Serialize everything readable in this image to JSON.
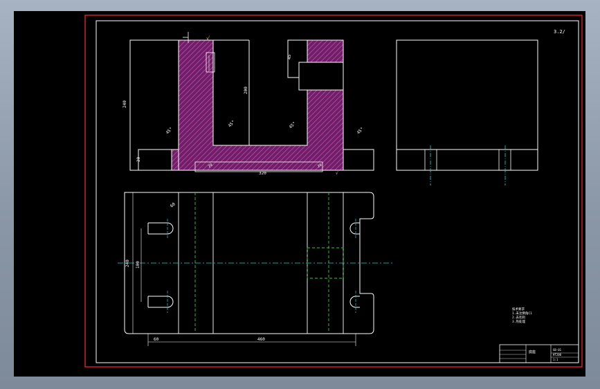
{
  "drawing": {
    "corner_mark": "3.2/",
    "roughness_note": "√",
    "top_view_dims": {
      "height_left": "240",
      "height_inner": "200",
      "depth_label": "45",
      "width_bottom": "320",
      "small_dim": "20",
      "angle_mark": "45°"
    },
    "plan_view_dims": {
      "height_total": "240",
      "height_slot": "100",
      "length_total": "460",
      "slot_offset": "60"
    },
    "notes_block": {
      "line1": "技术要求",
      "line2": "1.未注倒角C1",
      "line3": "2.去毛刺",
      "line4": "3.热处理"
    },
    "title_block": {
      "name": "底座",
      "code": "GB-01",
      "material": "HT200",
      "scale": "1:1"
    }
  },
  "colors": {
    "background": "#000000",
    "border_red": "#ff2a2a",
    "line_white": "#ffffff",
    "hatch_purple": "#9b2d8c",
    "centerline_cyan": "#1fd0d0",
    "hidden_green": "#2fd02f"
  }
}
